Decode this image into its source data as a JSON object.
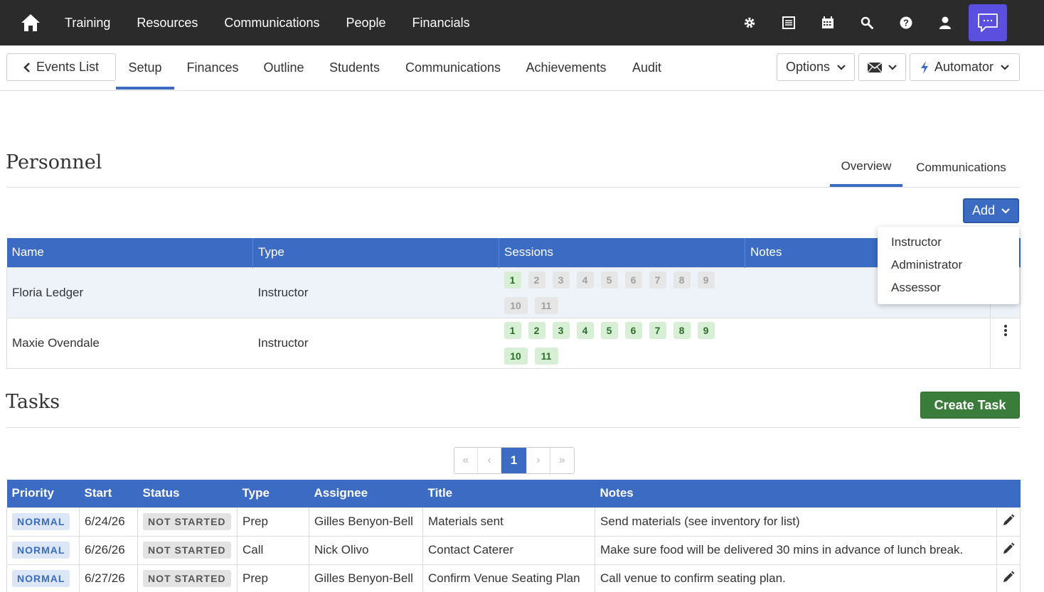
{
  "topnav": {
    "links": [
      "Training",
      "Resources",
      "Communications",
      "People",
      "Financials"
    ]
  },
  "subnav": {
    "back_label": "Events List",
    "tabs": [
      "Setup",
      "Finances",
      "Outline",
      "Students",
      "Communications",
      "Achievements",
      "Audit"
    ],
    "active_tab": "Setup",
    "options_label": "Options",
    "automator_label": "Automator"
  },
  "personnel": {
    "title": "Personnel",
    "tabs": [
      "Overview",
      "Communications"
    ],
    "add_label": "Add",
    "columns": [
      "Name",
      "Type",
      "Sessions",
      "Notes"
    ],
    "rows": [
      {
        "name": "Floria Ledger",
        "type": "Instructor",
        "sessions_active": [
          1
        ]
      },
      {
        "name": "Maxie Ovendale",
        "type": "Instructor",
        "sessions_active": [
          1,
          2,
          3,
          4,
          5,
          6,
          7,
          8,
          9,
          10,
          11
        ]
      }
    ],
    "session_numbers": [
      "1",
      "2",
      "3",
      "4",
      "5",
      "6",
      "7",
      "8",
      "9",
      "10",
      "11"
    ],
    "add_menu": [
      "Instructor",
      "Administrator",
      "Assessor"
    ]
  },
  "tasks": {
    "title": "Tasks",
    "create_label": "Create Task",
    "pager": {
      "first": "«",
      "prev": "‹",
      "current": "1",
      "next": "›",
      "last": "»"
    },
    "columns": [
      "Priority",
      "Start",
      "Status",
      "Type",
      "Assignee",
      "Title",
      "Notes"
    ],
    "rows": [
      {
        "priority": "NORMAL",
        "start": "6/24/26",
        "status": "NOT STARTED",
        "type": "Prep",
        "assignee": "Gilles Benyon-Bell",
        "title": "Materials sent",
        "notes": "Send materials (see inventory for list)"
      },
      {
        "priority": "NORMAL",
        "start": "6/26/26",
        "status": "NOT STARTED",
        "type": "Call",
        "assignee": "Nick Olivo",
        "title": "Contact Caterer",
        "notes": "Make sure food will be delivered 30 mins in advance of lunch break."
      },
      {
        "priority": "NORMAL",
        "start": "6/27/26",
        "status": "NOT STARTED",
        "type": "Prep",
        "assignee": "Gilles Benyon-Bell",
        "title": "Confirm Venue Seating Plan",
        "notes": "Call venue to confirm seating plan."
      }
    ]
  },
  "colors": {
    "nav_bg": "#2b2b2b",
    "primary": "#3b6bc2",
    "chat": "#5b4fe0",
    "success": "#3a7d3a",
    "session_on": "#d7f0d5"
  },
  "icons": [
    "home-icon",
    "gear-icon",
    "list-icon",
    "calendar-icon",
    "search-icon",
    "help-icon",
    "user-icon",
    "chat-icon",
    "chevron-left-icon",
    "chevron-down-icon",
    "mail-icon",
    "bolt-icon",
    "kebab-icon",
    "pencil-icon"
  ]
}
